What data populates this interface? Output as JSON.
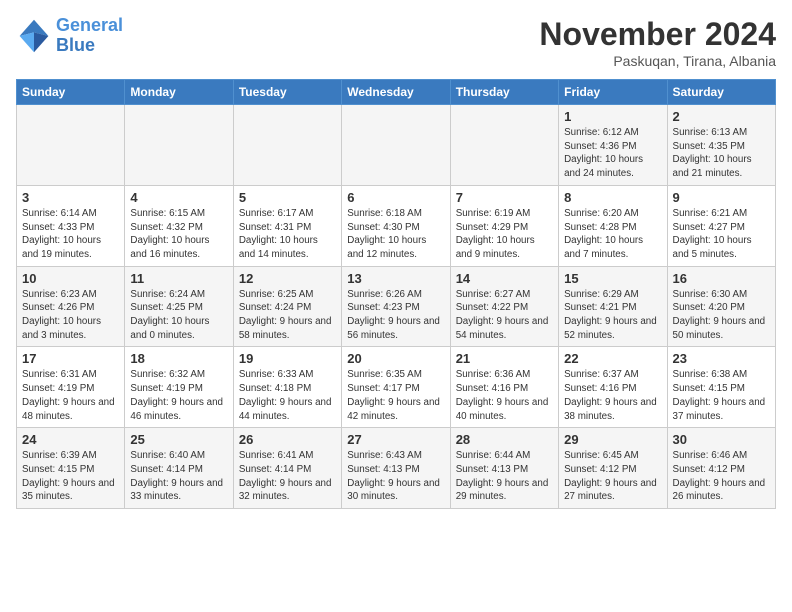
{
  "logo": {
    "line1": "General",
    "line2": "Blue"
  },
  "title": "November 2024",
  "location": "Paskuqan, Tirana, Albania",
  "days_of_week": [
    "Sunday",
    "Monday",
    "Tuesday",
    "Wednesday",
    "Thursday",
    "Friday",
    "Saturday"
  ],
  "weeks": [
    [
      {
        "day": "",
        "info": ""
      },
      {
        "day": "",
        "info": ""
      },
      {
        "day": "",
        "info": ""
      },
      {
        "day": "",
        "info": ""
      },
      {
        "day": "",
        "info": ""
      },
      {
        "day": "1",
        "info": "Sunrise: 6:12 AM\nSunset: 4:36 PM\nDaylight: 10 hours and 24 minutes."
      },
      {
        "day": "2",
        "info": "Sunrise: 6:13 AM\nSunset: 4:35 PM\nDaylight: 10 hours and 21 minutes."
      }
    ],
    [
      {
        "day": "3",
        "info": "Sunrise: 6:14 AM\nSunset: 4:33 PM\nDaylight: 10 hours and 19 minutes."
      },
      {
        "day": "4",
        "info": "Sunrise: 6:15 AM\nSunset: 4:32 PM\nDaylight: 10 hours and 16 minutes."
      },
      {
        "day": "5",
        "info": "Sunrise: 6:17 AM\nSunset: 4:31 PM\nDaylight: 10 hours and 14 minutes."
      },
      {
        "day": "6",
        "info": "Sunrise: 6:18 AM\nSunset: 4:30 PM\nDaylight: 10 hours and 12 minutes."
      },
      {
        "day": "7",
        "info": "Sunrise: 6:19 AM\nSunset: 4:29 PM\nDaylight: 10 hours and 9 minutes."
      },
      {
        "day": "8",
        "info": "Sunrise: 6:20 AM\nSunset: 4:28 PM\nDaylight: 10 hours and 7 minutes."
      },
      {
        "day": "9",
        "info": "Sunrise: 6:21 AM\nSunset: 4:27 PM\nDaylight: 10 hours and 5 minutes."
      }
    ],
    [
      {
        "day": "10",
        "info": "Sunrise: 6:23 AM\nSunset: 4:26 PM\nDaylight: 10 hours and 3 minutes."
      },
      {
        "day": "11",
        "info": "Sunrise: 6:24 AM\nSunset: 4:25 PM\nDaylight: 10 hours and 0 minutes."
      },
      {
        "day": "12",
        "info": "Sunrise: 6:25 AM\nSunset: 4:24 PM\nDaylight: 9 hours and 58 minutes."
      },
      {
        "day": "13",
        "info": "Sunrise: 6:26 AM\nSunset: 4:23 PM\nDaylight: 9 hours and 56 minutes."
      },
      {
        "day": "14",
        "info": "Sunrise: 6:27 AM\nSunset: 4:22 PM\nDaylight: 9 hours and 54 minutes."
      },
      {
        "day": "15",
        "info": "Sunrise: 6:29 AM\nSunset: 4:21 PM\nDaylight: 9 hours and 52 minutes."
      },
      {
        "day": "16",
        "info": "Sunrise: 6:30 AM\nSunset: 4:20 PM\nDaylight: 9 hours and 50 minutes."
      }
    ],
    [
      {
        "day": "17",
        "info": "Sunrise: 6:31 AM\nSunset: 4:19 PM\nDaylight: 9 hours and 48 minutes."
      },
      {
        "day": "18",
        "info": "Sunrise: 6:32 AM\nSunset: 4:19 PM\nDaylight: 9 hours and 46 minutes."
      },
      {
        "day": "19",
        "info": "Sunrise: 6:33 AM\nSunset: 4:18 PM\nDaylight: 9 hours and 44 minutes."
      },
      {
        "day": "20",
        "info": "Sunrise: 6:35 AM\nSunset: 4:17 PM\nDaylight: 9 hours and 42 minutes."
      },
      {
        "day": "21",
        "info": "Sunrise: 6:36 AM\nSunset: 4:16 PM\nDaylight: 9 hours and 40 minutes."
      },
      {
        "day": "22",
        "info": "Sunrise: 6:37 AM\nSunset: 4:16 PM\nDaylight: 9 hours and 38 minutes."
      },
      {
        "day": "23",
        "info": "Sunrise: 6:38 AM\nSunset: 4:15 PM\nDaylight: 9 hours and 37 minutes."
      }
    ],
    [
      {
        "day": "24",
        "info": "Sunrise: 6:39 AM\nSunset: 4:15 PM\nDaylight: 9 hours and 35 minutes."
      },
      {
        "day": "25",
        "info": "Sunrise: 6:40 AM\nSunset: 4:14 PM\nDaylight: 9 hours and 33 minutes."
      },
      {
        "day": "26",
        "info": "Sunrise: 6:41 AM\nSunset: 4:14 PM\nDaylight: 9 hours and 32 minutes."
      },
      {
        "day": "27",
        "info": "Sunrise: 6:43 AM\nSunset: 4:13 PM\nDaylight: 9 hours and 30 minutes."
      },
      {
        "day": "28",
        "info": "Sunrise: 6:44 AM\nSunset: 4:13 PM\nDaylight: 9 hours and 29 minutes."
      },
      {
        "day": "29",
        "info": "Sunrise: 6:45 AM\nSunset: 4:12 PM\nDaylight: 9 hours and 27 minutes."
      },
      {
        "day": "30",
        "info": "Sunrise: 6:46 AM\nSunset: 4:12 PM\nDaylight: 9 hours and 26 minutes."
      }
    ]
  ]
}
